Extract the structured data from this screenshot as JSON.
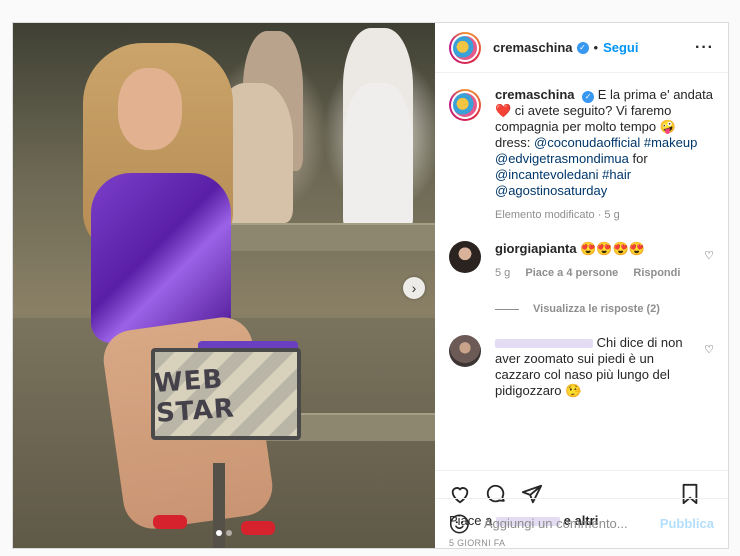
{
  "post": {
    "account": "cremaschina",
    "follow_label": "Segui",
    "more_icon": "more-options-icon",
    "caption": {
      "intro": "E la prima e' andata ❤️ ci avete seguito? Vi faremo compagnia per molto tempo 🤪 dress:",
      "tag1": "@coconudaofficial",
      "tag2": "#makeup",
      "tag3": "@edvigetrasmondimua",
      "for": "for",
      "tag4": "@incantevoledani",
      "tag5": "#hair",
      "tag6": "@agostinosaturday",
      "edited": "Elemento modificato · 5 g"
    },
    "image_sign": "WEB STAR",
    "carousel": {
      "count": 2,
      "active": 1
    }
  },
  "comments": [
    {
      "user": "giorgiapianta",
      "text": "😍😍😍😍",
      "age": "5 g",
      "likes": "Piace a 4 persone",
      "reply": "Rispondi"
    },
    {
      "view_replies": "Visualizza le risposte (2)"
    },
    {
      "text": "Chi dice di non aver zoomato sui piedi è un cazzaro col naso più lungo del pidigozzaro 🤥"
    }
  ],
  "footer": {
    "likes_prefix": "Piace a",
    "likes_suffix": "e altri",
    "time": "5 GIORNI FA",
    "comment_placeholder": "Aggiungi un commento...",
    "publish": "Pubblica"
  }
}
